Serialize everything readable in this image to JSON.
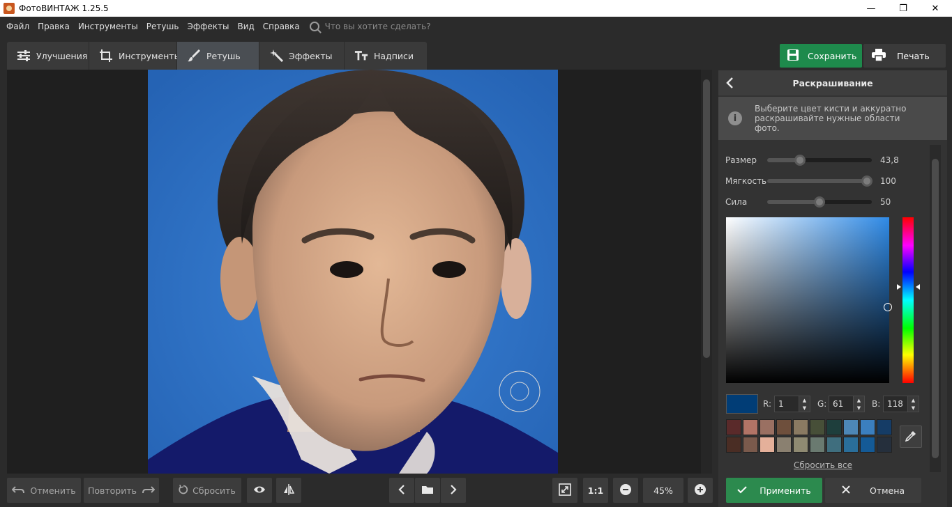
{
  "window": {
    "title": "ФотоВИНТАЖ 1.25.5",
    "minimize_glyph": "—",
    "maximize_glyph": "❐",
    "close_glyph": "✕"
  },
  "menu": {
    "items": [
      "Файл",
      "Правка",
      "Инструменты",
      "Ретушь",
      "Эффекты",
      "Вид",
      "Справка"
    ],
    "search_placeholder": "Что вы хотите сделать?"
  },
  "tabs": [
    {
      "label": "Улучшения",
      "icon": "sliders-icon",
      "active": false
    },
    {
      "label": "Инструменты",
      "icon": "crop-icon",
      "active": false
    },
    {
      "label": "Ретушь",
      "icon": "brush-icon",
      "active": true
    },
    {
      "label": "Эффекты",
      "icon": "magic-wand-icon",
      "active": false
    },
    {
      "label": "Надписи",
      "icon": "text-icon",
      "active": false
    }
  ],
  "top_actions": {
    "save_label": "Сохранить",
    "print_label": "Печать",
    "save_color": "#1e8a4c"
  },
  "panel": {
    "title": "Раскрашивание",
    "info_icon_glyph": "i",
    "info_text": "Выберите цвет кисти и аккуратно раскрашивайте нужные области фото.",
    "sliders": [
      {
        "label": "Размер",
        "value_text": "43,8",
        "fraction": 0.31
      },
      {
        "label": "Мягкость",
        "value_text": "100",
        "fraction": 0.95
      },
      {
        "label": "Сила",
        "value_text": "50",
        "fraction": 0.5
      }
    ],
    "color": {
      "current_hex": "#013d76",
      "hue_fraction": 0.42,
      "saturation": 0.99,
      "brightness": 0.46,
      "r_label": "R:",
      "g_label": "G:",
      "b_label": "B:",
      "r": "1",
      "g": "61",
      "b": "118",
      "spin_up": "▲",
      "spin_down": "▼"
    },
    "palette": [
      "#5a2a2a",
      "#b27466",
      "#9a7062",
      "#6e4f3c",
      "#8a7a62",
      "#474f38",
      "#1e3e3c",
      "#4d87b6",
      "#3b7fbf",
      "#153c66",
      "#4a2d24",
      "#7a5a4c",
      "#e4b09a",
      "#8a8070",
      "#8f8a72",
      "#6a7a70",
      "#3f6e7e",
      "#2a6e9a",
      "#145a96",
      "#252f3c"
    ],
    "reset_label": "Сбросить все",
    "apply_label": "Применить",
    "cancel_label": "Отмена"
  },
  "bottom": {
    "undo_label": "Отменить",
    "redo_label": "Повторить",
    "reset_label": "Сбросить",
    "zoom_one_label": "1:1",
    "zoom_value": "45%"
  }
}
